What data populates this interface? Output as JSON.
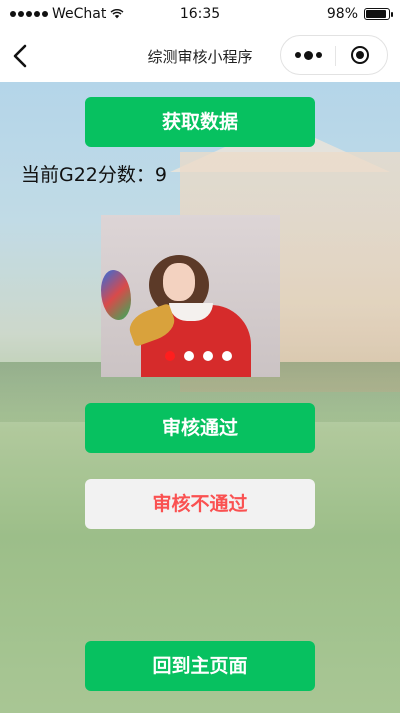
{
  "status_bar": {
    "carrier": "WeChat",
    "time": "16:35",
    "battery": "98%",
    "battery_level": 0.98
  },
  "nav": {
    "title": "综测审核小程序"
  },
  "main": {
    "fetch_button": "获取数据",
    "score_label": "当前G22分数：9",
    "swiper": {
      "slide_count": 4,
      "active_index": 0
    },
    "approve_button": "审核通过",
    "reject_button": "审核不通过",
    "home_button": "回到主页面"
  },
  "colors": {
    "primary_green": "#07c160",
    "reject_red": "#fa5151",
    "indicator_active": "#ff1e1e"
  },
  "icons": {
    "back": "chevron-left-icon",
    "more": "more-dots-icon",
    "close": "target-circle-icon",
    "signal": "signal-dots-icon",
    "wifi": "wifi-icon",
    "battery": "battery-icon"
  }
}
